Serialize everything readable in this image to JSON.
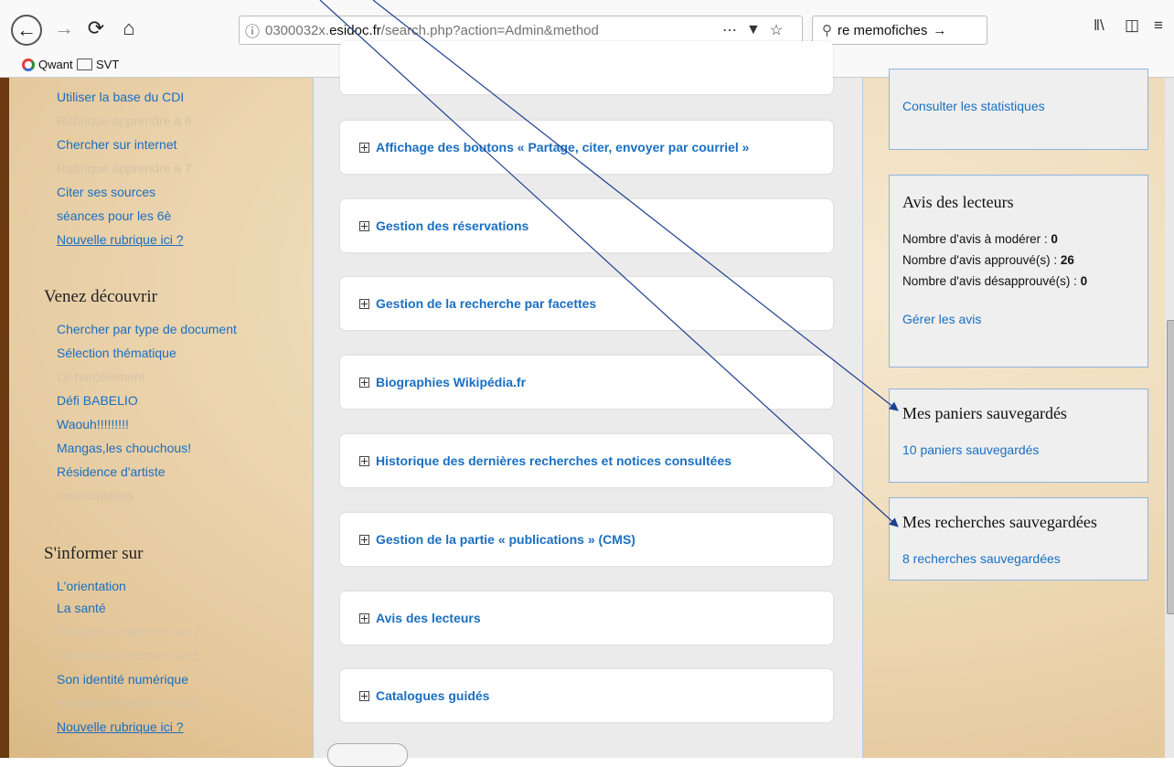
{
  "browser": {
    "url_prefix": "0300032x.",
    "url_domain": "esidoc.fr",
    "url_path": "/search.php?action=Admin&method",
    "search_text": "re memofiches",
    "bookmarks": [
      "Qwant",
      "SVT"
    ]
  },
  "left": {
    "links_top": [
      "Utiliser la base du CDI",
      "Rubrique apprendre à 6",
      "Chercher sur internet",
      "Rubrique apprendre à 7",
      "Citer ses sources",
      "séances pour les 6è",
      "Nouvelle rubrique ici ?"
    ],
    "venez_title": "Venez découvrir",
    "venez_links": [
      "Chercher par type de document",
      "Sélection thématique",
      "Le harcèlement",
      "Défi BABELIO",
      "Waouh!!!!!!!!!",
      "Mangas,les chouchous!",
      "Résidence d'artiste",
      "Incorruptibles"
    ],
    "informer_title": "S'informer sur",
    "informer_links": [
      "L'orientation",
      "La santé",
      "Rubrique s'informer sur 7",
      "Rubrique s'informer sur 5",
      "Son identité numérique",
      "Rubrique s'informer sur 6",
      "Nouvelle rubrique ici ?"
    ]
  },
  "center": {
    "cards": [
      "Affichage des boutons « Partage, citer, envoyer par courriel »",
      "Gestion des réservations",
      "Gestion de la recherche par facettes",
      "Biographies Wikipédia.fr",
      "Historique des dernières recherches et notices consultées",
      "Gestion de la partie « publications » (CMS)",
      "Avis des lecteurs",
      "Catalogues guidés"
    ]
  },
  "right": {
    "stats_link": "Consulter les statistiques",
    "avis": {
      "title": "Avis des lecteurs",
      "moderer_label": "Nombre d'avis à modérer : ",
      "moderer_value": "0",
      "approuves_label": "Nombre d'avis approuvé(s) : ",
      "approuves_value": "26",
      "desapprouves_label": "Nombre d'avis désapprouvé(s) : ",
      "desapprouves_value": "0",
      "gerer_link": "Gérer les avis"
    },
    "paniers": {
      "title": "Mes paniers sauvegardés",
      "link": "10 paniers sauvegardés"
    },
    "recherches": {
      "title": "Mes recherches sauvegardées",
      "link": "8 recherches sauvegardées"
    }
  },
  "colors": {
    "link": "#1a6fc1",
    "arrow": "#1f3f8f",
    "box_border": "#8fb3dc"
  }
}
